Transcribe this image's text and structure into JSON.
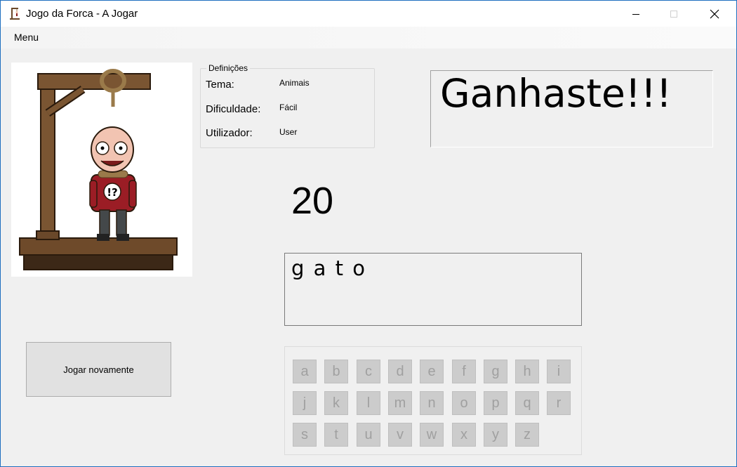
{
  "window": {
    "title": "Jogo da Forca - A Jogar",
    "controls": {
      "minimize": "—",
      "maximize": "☐",
      "close": "✕"
    },
    "border_color": "#1e6fbf"
  },
  "menu": {
    "items": [
      {
        "label": "Menu"
      }
    ]
  },
  "hangman_image": {
    "icon": "hangman-gallows-image"
  },
  "settings": {
    "legend": "Definições",
    "rows": [
      {
        "label": "Tema:",
        "value": "Animais"
      },
      {
        "label": "Dificuldade:",
        "value": "Fácil"
      },
      {
        "label": "Utilizador:",
        "value": "User"
      }
    ]
  },
  "result": {
    "text": "Ganhaste!!!"
  },
  "counter": {
    "value": "20"
  },
  "word": {
    "display": "g a t o"
  },
  "actions": {
    "play_again_label": "Jogar novamente"
  },
  "keyboard": {
    "rows": [
      [
        "a",
        "b",
        "c",
        "d",
        "e",
        "f",
        "g",
        "h",
        "i"
      ],
      [
        "j",
        "k",
        "l",
        "m",
        "n",
        "o",
        "p",
        "q",
        "r"
      ],
      [
        "s",
        "t",
        "u",
        "v",
        "w",
        "x",
        "y",
        "z"
      ]
    ],
    "state": "disabled",
    "key_color": "#cccccc",
    "key_text_color": "#a0a0a0"
  }
}
